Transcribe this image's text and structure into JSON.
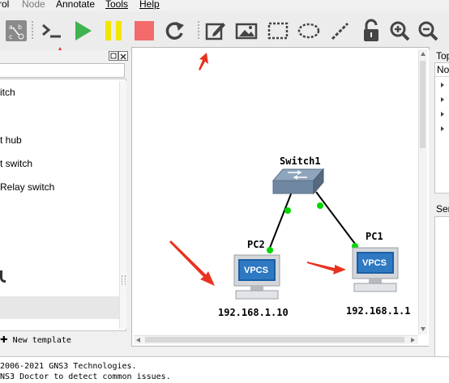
{
  "menu": {
    "control": "rol",
    "node": "Node",
    "annotate": "Annotate",
    "tools": "Tools",
    "help": "Help"
  },
  "toolbar": {
    "icons": [
      "browse-devices-icon",
      "console-all-icon",
      "start-all-icon",
      "suspend-all-icon",
      "stop-all-icon",
      "reload-all-icon",
      "add-note-icon",
      "insert-image-icon",
      "draw-rectangle-icon",
      "draw-ellipse-icon",
      "draw-line-icon",
      "lock-unlock-icon",
      "zoom-in-icon",
      "zoom-out-icon"
    ],
    "colors": {
      "start": "#3fb34f",
      "suspend": "#f2e500",
      "stop": "#f46b6b"
    }
  },
  "left_panel": {
    "search_placeholder": "",
    "items": [
      "itch",
      "t hub",
      "t switch",
      "Relay switch"
    ],
    "new_template_label": "New template"
  },
  "topology": {
    "switch_label": "Switch1",
    "pc1_label": "PC1",
    "pc2_label": "PC2",
    "pc1_ip": "192.168.1.1",
    "pc2_ip": "192.168.1.10",
    "vpcs_text": "VPCS",
    "link_color": "#00d800"
  },
  "right_panel": {
    "top_title": "Top",
    "top_header": "No",
    "servers_title": "Ser"
  },
  "console": {
    "line1": "2006-2021 GNS3 Technologies.",
    "line2": "NS3 Doctor to detect common issues."
  }
}
